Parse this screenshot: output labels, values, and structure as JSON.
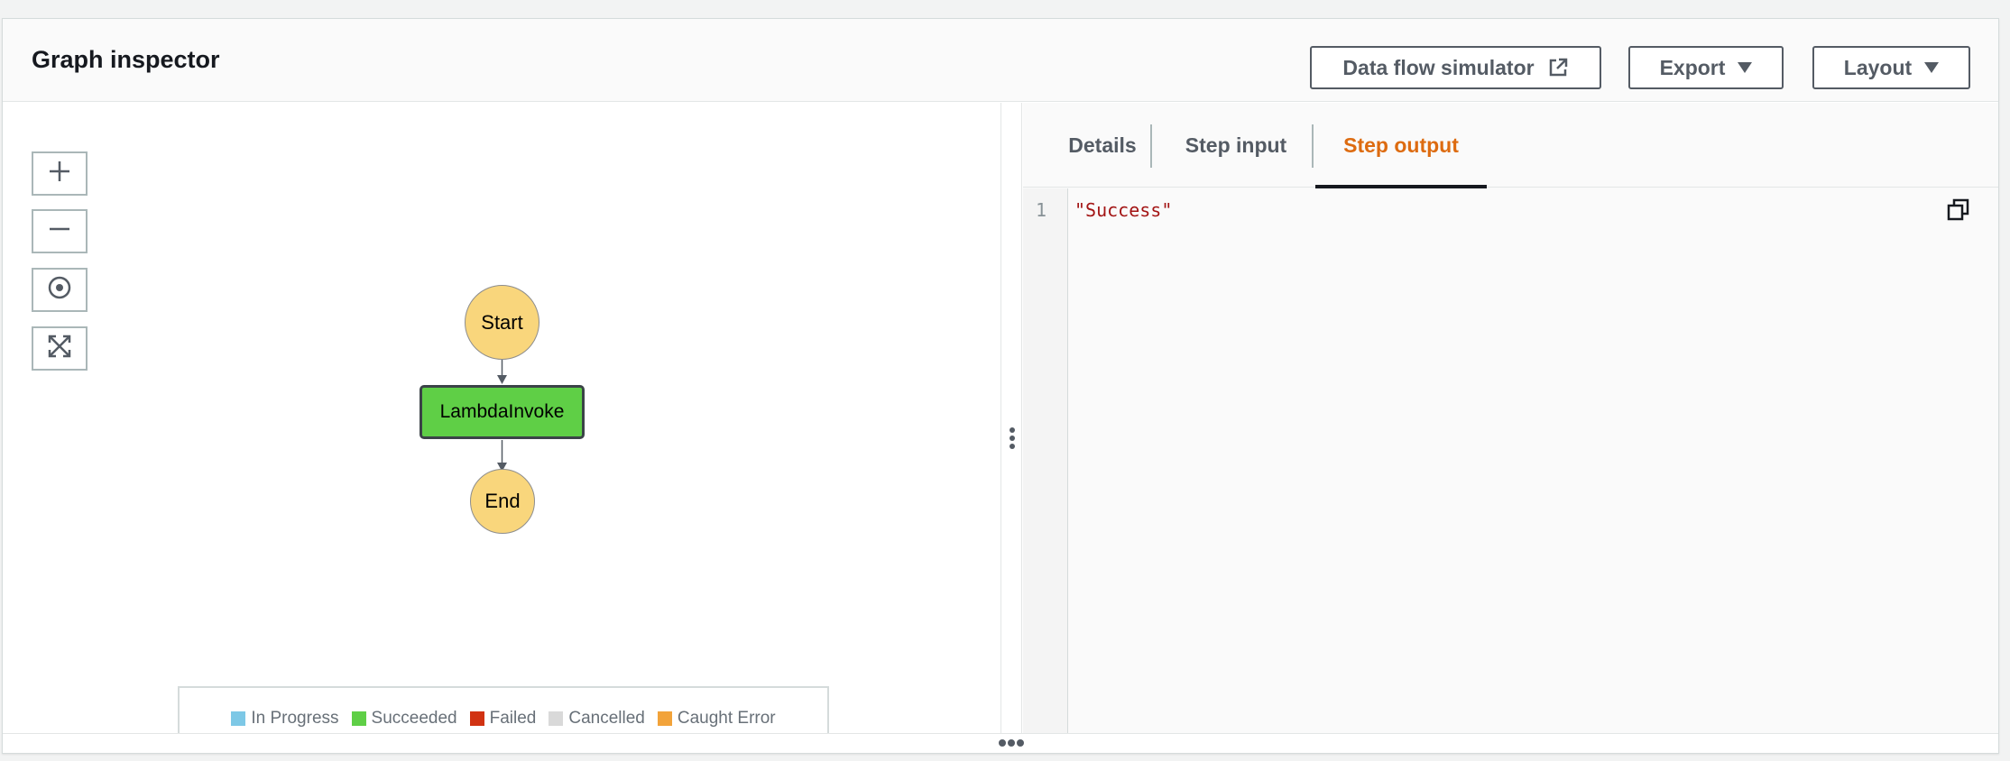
{
  "header": {
    "title": "Graph inspector",
    "buttons": {
      "data_flow": "Data flow simulator",
      "export": "Export",
      "layout": "Layout"
    }
  },
  "graph": {
    "zoom_controls": [
      "zoom-in",
      "zoom-out",
      "center",
      "fit"
    ],
    "nodes": {
      "start": "Start",
      "task": "LambdaInvoke",
      "end": "End"
    },
    "legend": [
      {
        "label": "In Progress",
        "color": "#7dc8e6"
      },
      {
        "label": "Succeeded",
        "color": "#5fcf46"
      },
      {
        "label": "Failed",
        "color": "#d13212"
      },
      {
        "label": "Cancelled",
        "color": "#d9d9d9"
      },
      {
        "label": "Caught Error",
        "color": "#f2a33a"
      }
    ]
  },
  "detail": {
    "tabs": [
      "Details",
      "Step input",
      "Step output"
    ],
    "active_tab": "Step output",
    "editor": {
      "line_number": "1",
      "content": "\"Success\""
    }
  },
  "colors": {
    "accent": "#dd6b10",
    "node_start_end": "#f9d67c",
    "node_succeeded": "#5fcf46"
  }
}
